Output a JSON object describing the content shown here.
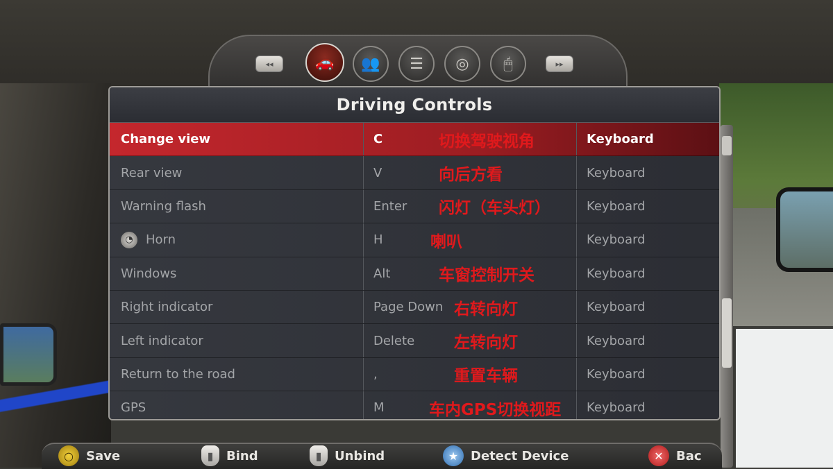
{
  "header": {
    "title": "Driving Controls",
    "prev_label": "◂◂",
    "next_label": "▸▸",
    "tabs": [
      {
        "name": "car",
        "glyph": "🚗"
      },
      {
        "name": "people",
        "glyph": "👥"
      },
      {
        "name": "settings-list",
        "glyph": "☰"
      },
      {
        "name": "steering-wheel",
        "glyph": "◎"
      },
      {
        "name": "mouse",
        "glyph": "🖱"
      }
    ]
  },
  "bindings": [
    {
      "action": "Change view",
      "key": "C",
      "note": "切换驾驶视角",
      "device": "Keyboard",
      "selected": true
    },
    {
      "action": "Rear view",
      "key": "V",
      "note": "向后方看",
      "device": "Keyboard"
    },
    {
      "action": "Warning flash",
      "key": "Enter",
      "note": "闪灯（车头灯）",
      "device": "Keyboard"
    },
    {
      "action": "Horn",
      "key": "H",
      "note": "喇叭",
      "device": "Keyboard",
      "icon": "horn-icon"
    },
    {
      "action": "Windows",
      "key": "Alt",
      "note": "车窗控制开关",
      "device": "Keyboard"
    },
    {
      "action": "Right indicator",
      "key": "Page Down",
      "note": "右转向灯",
      "device": "Keyboard"
    },
    {
      "action": "Left indicator",
      "key": "Delete",
      "note": "左转向灯",
      "device": "Keyboard"
    },
    {
      "action": "Return to the road",
      "key": ",",
      "note": "重置车辆",
      "device": "Keyboard"
    },
    {
      "action": "GPS",
      "key": "M",
      "note": "车内GPS切换视距",
      "device": "Keyboard"
    }
  ],
  "footer": {
    "save_label": "Save",
    "bind_label": "Bind",
    "unbind_label": "Unbind",
    "detect_label": "Detect Device",
    "back_label": "Bac"
  }
}
